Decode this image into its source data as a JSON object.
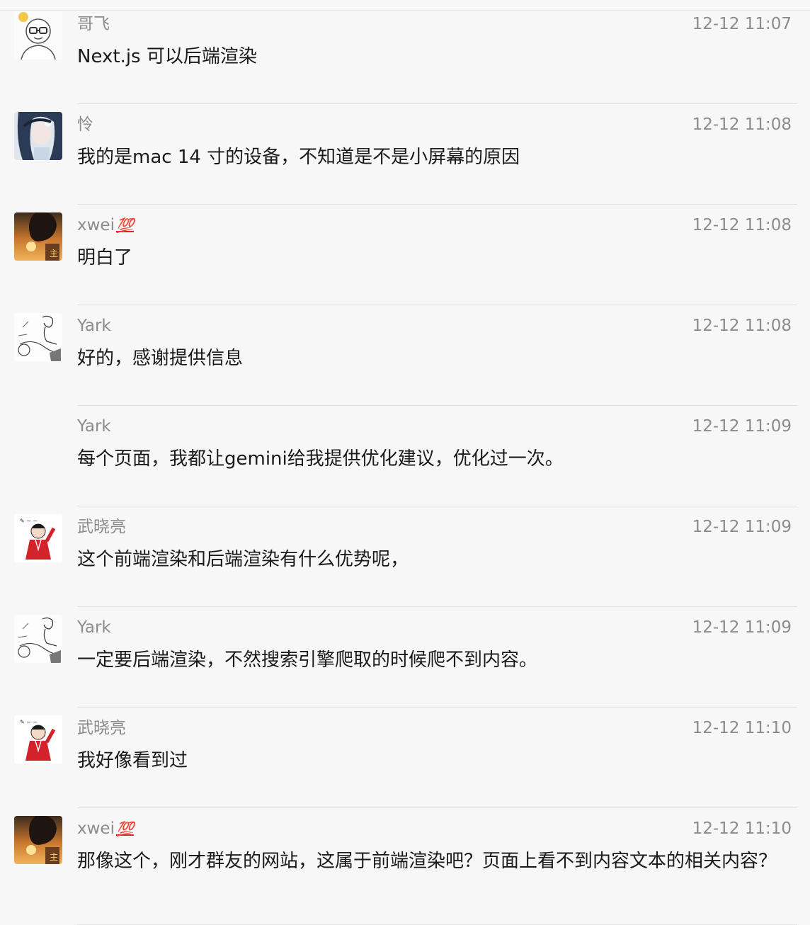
{
  "messages": [
    {
      "avatar": "bald-glasses-man-avatar",
      "name": "哥飞",
      "badge": "",
      "time": "12-12 11:07",
      "text": "Next.js 可以后端渲染"
    },
    {
      "avatar": "anime-girl-avatar",
      "name": "怜",
      "badge": "",
      "time": "12-12 11:08",
      "text": "我的是mac 14 寸的设备，不知道是不是小屏幕的原因"
    },
    {
      "avatar": "sunset-silhouette-avatar",
      "name": "xwei",
      "badge": "💯",
      "time": "12-12 11:08",
      "text": "明白了"
    },
    {
      "avatar": "sketch-rider-avatar",
      "name": "Yark",
      "badge": "",
      "time": "12-12 11:08",
      "text": "好的，感谢提供信息"
    },
    {
      "avatar": "",
      "name": "Yark",
      "badge": "",
      "time": "12-12 11:09",
      "text": "每个页面，我都让gemini给我提供优化建议，优化过一次。"
    },
    {
      "avatar": "red-robe-figure-avatar",
      "name": "武晓亮",
      "badge": "",
      "time": "12-12 11:09",
      "text": "这个前端渲染和后端渲染有什么优势呢，"
    },
    {
      "avatar": "sketch-rider-avatar",
      "name": "Yark",
      "badge": "",
      "time": "12-12 11:09",
      "text": "一定要后端渲染，不然搜索引擎爬取的时候爬不到内容。"
    },
    {
      "avatar": "red-robe-figure-avatar",
      "name": "武晓亮",
      "badge": "",
      "time": "12-12 11:10",
      "text": "我好像看到过"
    },
    {
      "avatar": "sunset-silhouette-avatar",
      "name": "xwei",
      "badge": "💯",
      "time": "12-12 11:10",
      "text": "那像这个，刚才群友的网站，这属于前端渲染吧？页面上看不到内容文本的相关内容？"
    }
  ]
}
